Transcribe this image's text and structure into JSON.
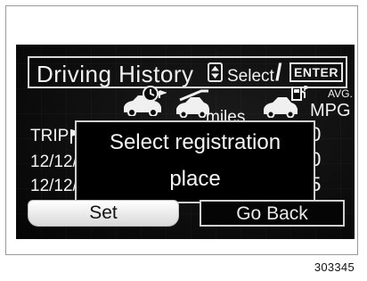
{
  "header": {
    "title": "Driving History",
    "select_label": "Select",
    "separator": "/",
    "enter_key_label": "ENTER"
  },
  "columns": {
    "miles_label": "miles",
    "avg_label": "AVG.",
    "mpg_label": "MPG",
    "icons": [
      "car-clock-icon",
      "car-distance-icon",
      "car-fuel-icon"
    ]
  },
  "rows": [
    {
      "label": "TRIP",
      "value": ".0"
    },
    {
      "label": "12/12/",
      "value": ".0"
    },
    {
      "label": "12/12/",
      "value": ".5"
    }
  ],
  "dialog": {
    "line1": "Select registration",
    "line2": "place"
  },
  "buttons": {
    "set_label": "Set",
    "back_label": "Go Back"
  },
  "figure_ref": "303345",
  "colors": {
    "screen_bg": "#0b0b0b",
    "text": "#f2f2f2",
    "selected_button": "#f0f0f0"
  }
}
